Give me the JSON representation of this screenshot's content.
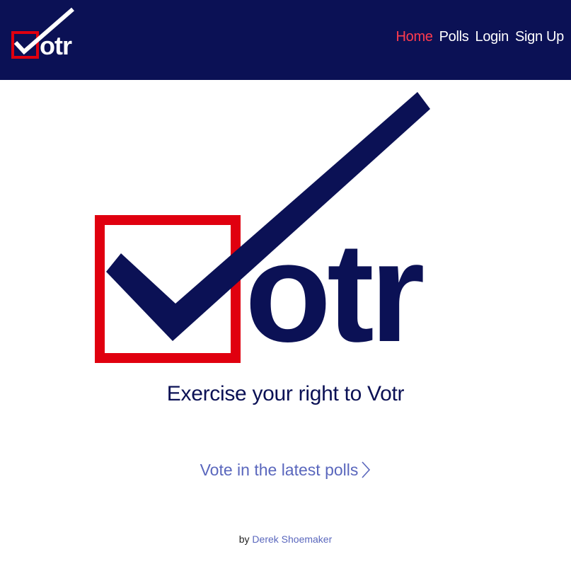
{
  "nav": {
    "logo_text": "Votr",
    "links": [
      {
        "label": "Home",
        "active": true
      },
      {
        "label": "Polls",
        "active": false
      },
      {
        "label": "Login",
        "active": false
      },
      {
        "label": "Sign Up",
        "active": false
      }
    ]
  },
  "hero": {
    "logo_text": "Votr",
    "tagline": "Exercise your right to Votr"
  },
  "cta": {
    "label": "Vote in the latest polls",
    "icon": "chevron-right-icon"
  },
  "footer": {
    "prefix": "by",
    "author": "Derek Shoemaker"
  },
  "colors": {
    "navy": "#0b1155",
    "red": "#e0000f",
    "active_link": "#ff3b4e",
    "link": "#5a67bd",
    "background": "#ffffff"
  }
}
